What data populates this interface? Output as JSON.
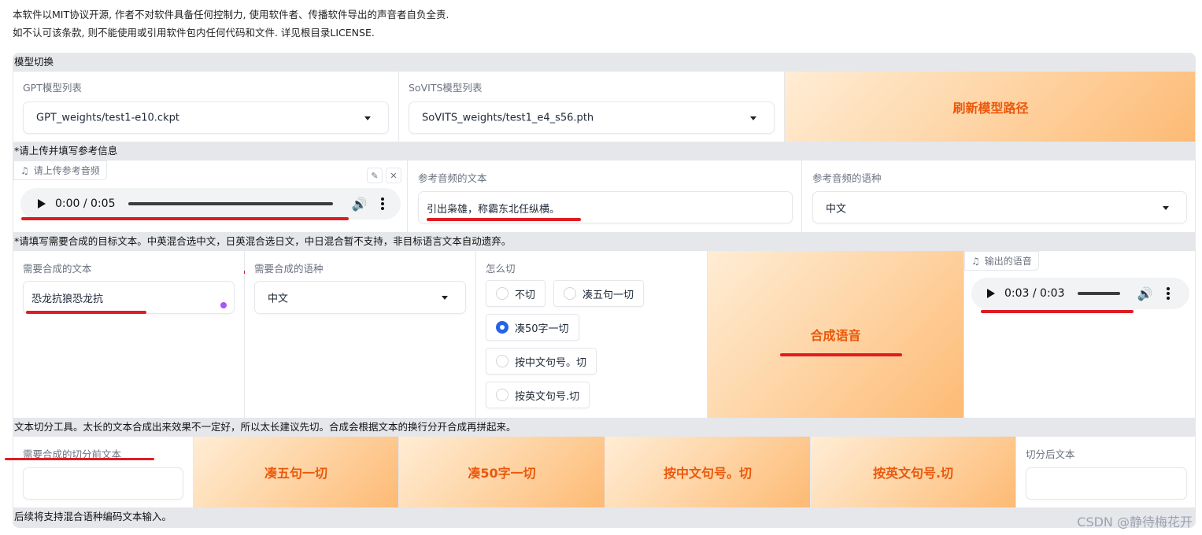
{
  "disclaimer": {
    "line1": "本软件以MIT协议开源, 作者不对软件具备任何控制力, 使用软件者、传播软件导出的声音者自负全责.",
    "line2": "如不认可该条款, 则不能使用或引用软件包内任何代码和文件. 详见根目录LICENSE."
  },
  "model_switch": {
    "header": "模型切换",
    "gpt_label": "GPT模型列表",
    "gpt_value": "GPT_weights/test1-e10.ckpt",
    "sovits_label": "SoVITS模型列表",
    "sovits_value": "SoVITS_weights/test1_e4_s56.pth",
    "refresh_button": "刷新模型路径"
  },
  "reference": {
    "header": "*请上传并填写参考信息",
    "upload_tag": "请上传参考音频",
    "audio_time": "0:00 / 0:05",
    "text_label": "参考音频的文本",
    "text_value": "引出枭雄，称霸东北任纵横。",
    "lang_label": "参考音频的语种",
    "lang_value": "中文"
  },
  "target": {
    "header": "*请填写需要合成的目标文本。中英混合选中文，日英混合选日文，中日混合暂不支持，非目标语言文本自动遗弃。",
    "text_label": "需要合成的文本",
    "text_value": "恐龙抗狼恐龙抗",
    "lang_label": "需要合成的语种",
    "lang_value": "中文",
    "cut_label": "怎么切",
    "cut_options": [
      "不切",
      "凑五句一切",
      "凑50字一切",
      "按中文句号。切",
      "按英文句号.切"
    ],
    "cut_selected": 2,
    "synth_button": "合成语音",
    "output_tag": "输出的语音",
    "output_time": "0:03 / 0:03"
  },
  "split_tool": {
    "header": "文本切分工具。太长的文本合成出来效果不一定好，所以太长建议先切。合成会根据文本的换行分开合成再拼起来。",
    "input_label": "需要合成的切分前文本",
    "buttons": [
      "凑五句一切",
      "凑50字一切",
      "按中文句号。切",
      "按英文句号.切"
    ],
    "output_label": "切分后文本"
  },
  "footer_note": "后续将支持混合语种编码文本输入。",
  "watermark": "CSDN @静待梅花开",
  "colors": {
    "accent_orange": "#ea580c",
    "radio_blue": "#2563eb",
    "annotation_red": "#e01b24"
  }
}
